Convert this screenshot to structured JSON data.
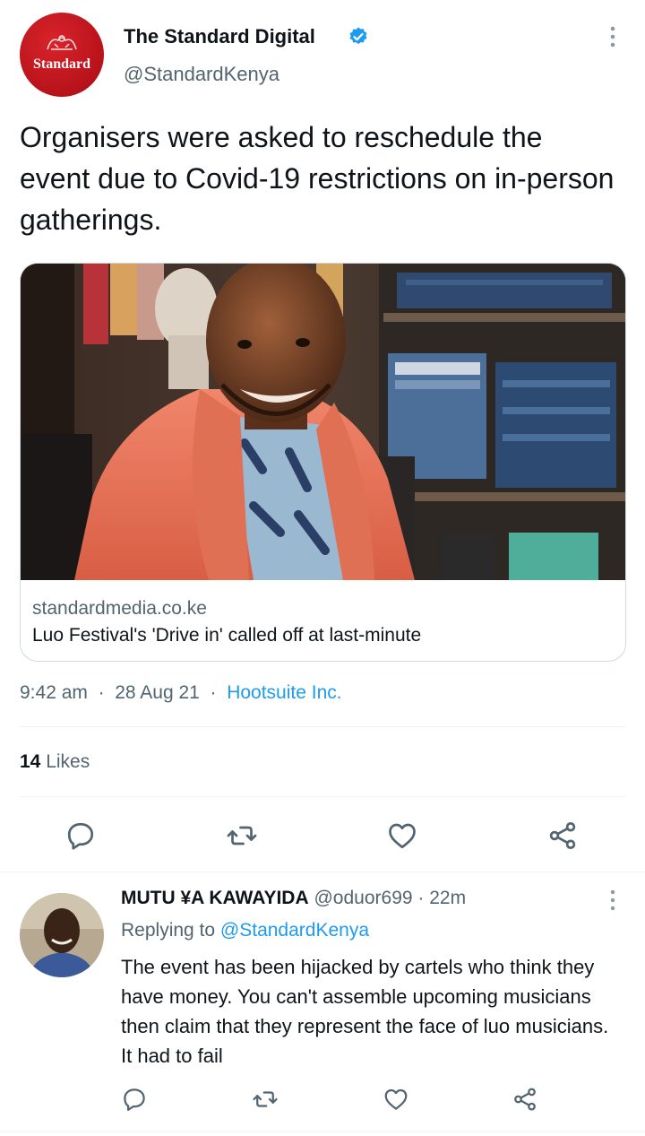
{
  "tweet": {
    "author_name": "The Standard Digital",
    "handle": "@StandardKenya",
    "avatar_text": "Standard",
    "text": "Organisers were asked to reschedule the event due to Covid-19 restrictions on in-person gatherings.",
    "card": {
      "domain": "standardmedia.co.ke",
      "title": "Luo Festival's 'Drive in' called off at last-minute"
    },
    "meta": {
      "time": "9:42 am",
      "date": "28 Aug 21",
      "source": "Hootsuite Inc."
    },
    "likes_count": "14",
    "likes_label": "Likes"
  },
  "reply": {
    "author_name": "MUTU ¥A KAWAYIDA",
    "handle": "@oduor699",
    "time": "22m",
    "replying_prefix": "Replying to",
    "replying_to": "@StandardKenya",
    "text": "The event has been hijacked by cartels who think they have money. You can't assemble upcoming musicians then claim that they represent the face of luo musicians. It had to fail"
  },
  "colors": {
    "link": "#1d9bf0",
    "secondary_text": "#536471",
    "brand_red": "#c0141c"
  },
  "icons": [
    "verified-badge-icon",
    "more-icon",
    "reply-icon",
    "retweet-icon",
    "like-icon",
    "share-icon"
  ]
}
